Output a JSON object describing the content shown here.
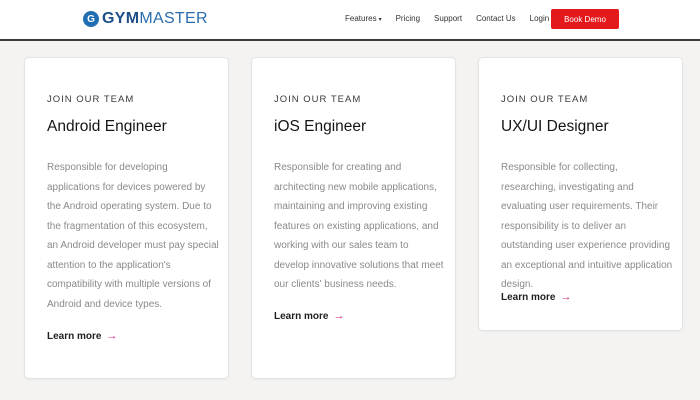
{
  "header": {
    "logo": {
      "prefix": "GYM",
      "suffix": "MASTER",
      "mark": "G"
    },
    "nav": [
      {
        "label": "Features",
        "has_caret": true
      },
      {
        "label": "Pricing"
      },
      {
        "label": "Support"
      },
      {
        "label": "Contact Us"
      },
      {
        "label": "Login"
      }
    ],
    "cta": "Book Demo",
    "cta_color": "#e3191c"
  },
  "cards": [
    {
      "eyebrow": "JOIN OUR TEAM",
      "title": "Android Engineer",
      "description": "Responsible for developing applications for devices powered by the Android operating system. Due to the fragmentation of this ecosystem, an Android developer must pay special attention to the application's compatibility with multiple versions of Android and device types.",
      "link": "Learn more"
    },
    {
      "eyebrow": "JOIN OUR TEAM",
      "title": "iOS Engineer",
      "description": "Responsible for creating and architecting new mobile applications, maintaining and improving existing features on existing applications, and working with our sales team to develop innovative solutions that meet our clients' business needs.",
      "link": "Learn more"
    },
    {
      "eyebrow": "JOIN OUR TEAM",
      "title": "UX/UI Designer",
      "description": "Responsible for collecting, researching, investigating and evaluating user requirements. Their responsibility is to deliver an outstanding user experience providing an exceptional and intuitive application design.",
      "link": "Learn more"
    }
  ],
  "icons": {
    "arrow": "arrow-right-icon",
    "caret": "chevron-down-icon"
  },
  "colors": {
    "accent_arrow": "#d6197e",
    "brand_blue": "#1f4f86"
  }
}
